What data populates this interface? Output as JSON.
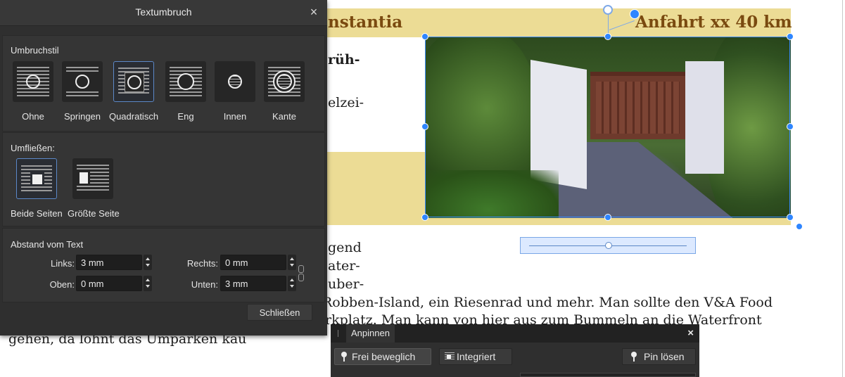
{
  "document": {
    "heading_left": "nstantia",
    "heading_right": "Anfahrt xx 40 km",
    "fragments": [
      "rüh-",
      "elzei-",
      "gend",
      "ater-",
      "uber-"
    ],
    "line1": "Robben-Island, ein Riesenrad und mehr. Man sollte den V&A Food",
    "line2": "rkplatz. Man kann von hier aus zum Bummeln an die Waterfront",
    "line3": "gehen, da lohnt das Umparken kau"
  },
  "dialog": {
    "title": "Textumbruch",
    "close_icon": "×",
    "umbruchstil": {
      "label": "Umbruchstil",
      "options": [
        "Ohne",
        "Springen",
        "Quadratisch",
        "Eng",
        "Innen",
        "Kante"
      ],
      "selected": "Quadratisch"
    },
    "umfliessen": {
      "label": "Umfließen:",
      "options": [
        "Beide Seiten",
        "Größte Seite"
      ],
      "selected": "Beide Seiten"
    },
    "abstand": {
      "label": "Abstand vom Text",
      "links_label": "Links:",
      "links_value": "3 mm",
      "rechts_label": "Rechts:",
      "rechts_value": "0 mm",
      "oben_label": "Oben:",
      "oben_value": "0 mm",
      "unten_label": "Unten:",
      "unten_value": "3 mm"
    },
    "close_button": "Schließen"
  },
  "pin_panel": {
    "tab": "Anpinnen",
    "close_icon": "×",
    "free_button": "Frei beweglich",
    "integrated_button": "Integriert",
    "unpin_button": "Pin lösen"
  }
}
